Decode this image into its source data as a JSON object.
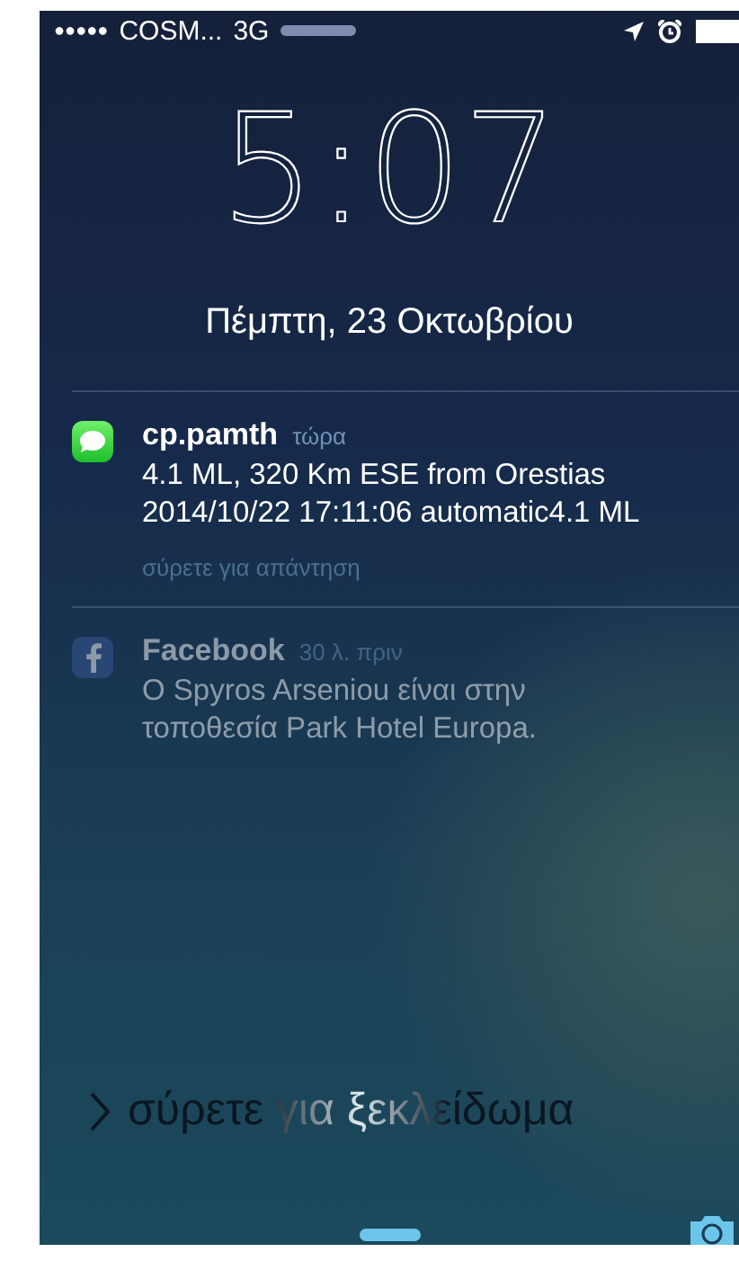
{
  "status_bar": {
    "signal_dots": "●●●●●",
    "carrier": "COSM...",
    "network": "3G"
  },
  "clock": {
    "time": "5:07",
    "date": "Πέμπτη, 23 Οκτωβρίου"
  },
  "notifications": [
    {
      "kind": "messages",
      "sender": "cp.pamth",
      "time": "τώρα",
      "body": "4.1 ML, 320 Km ESE from Orestias 2014/10/22 17:11:06 automatic4.1 ML",
      "action": "σύρετε για απάντηση",
      "dimmed": false
    },
    {
      "kind": "facebook",
      "sender": "Facebook",
      "time": "30 λ. πριν",
      "body": "O Spyros Arseniou είναι στην τοποθεσία Park Hotel Europa.",
      "dimmed": true
    }
  ],
  "unlock": {
    "label": "σύρετε για ξεκλείδωμα"
  }
}
